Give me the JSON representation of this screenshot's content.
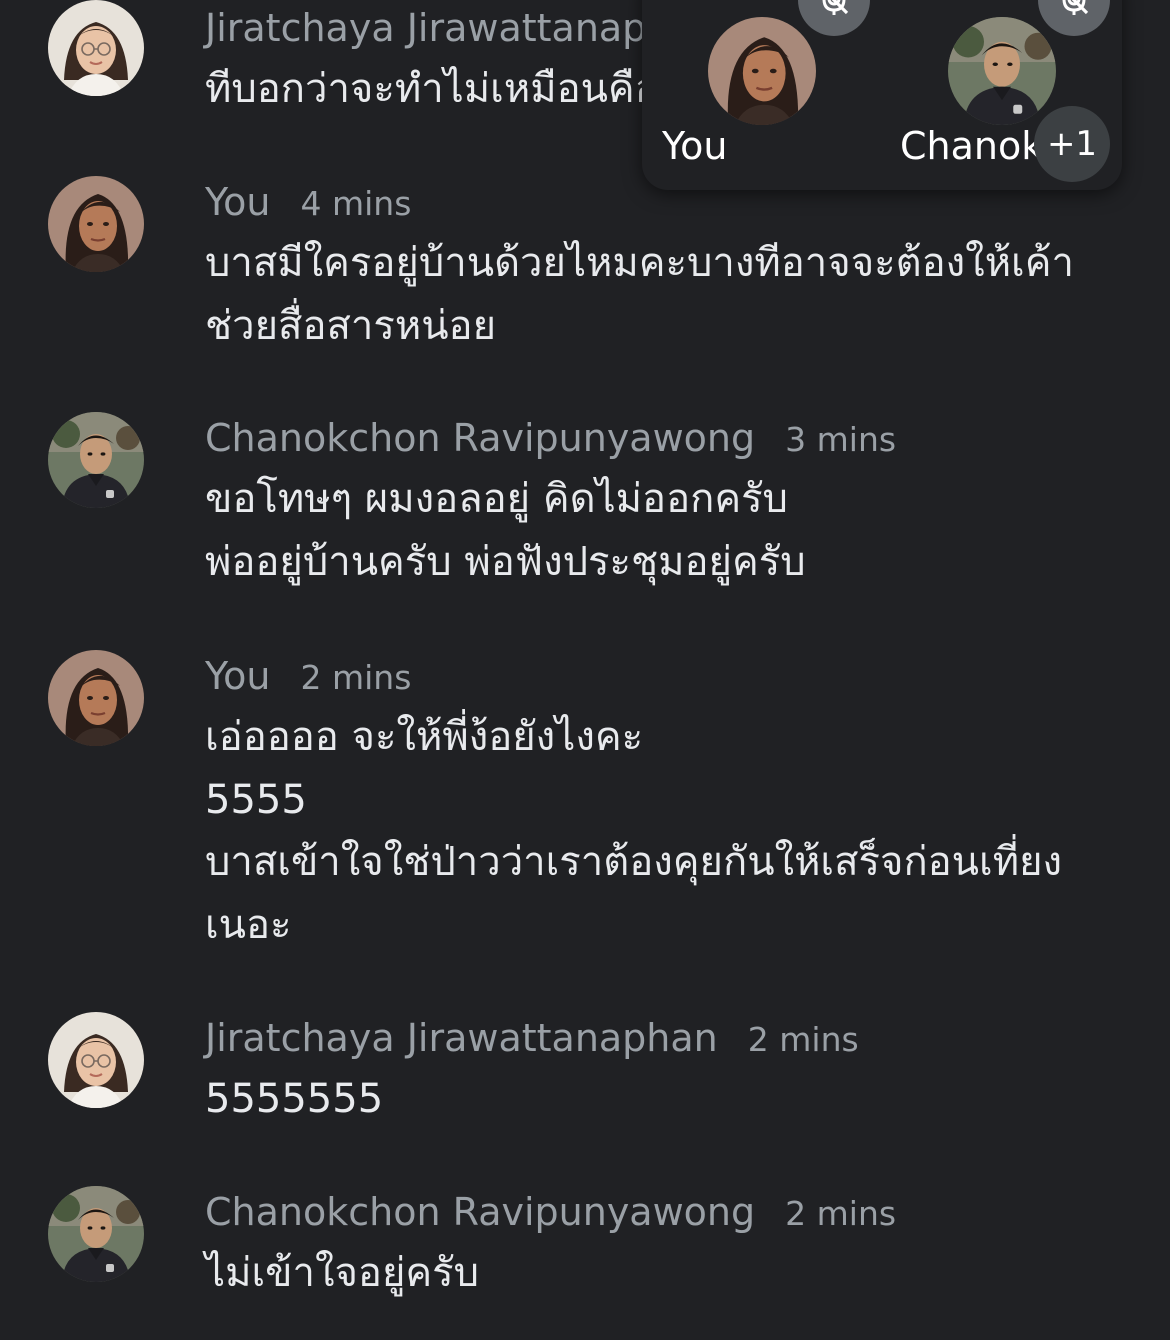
{
  "messages": [
    {
      "sender": "Jiratchaya Jirawattanaphan",
      "time": "",
      "lines": [
        "ทีบอกว่าจะทำไม่เหมือนคือ"
      ]
    },
    {
      "sender": "You",
      "time": "4 mins",
      "lines": [
        "บาสมีใครอยู่บ้านด้วยไหมคะบางทีอาจจะต้องให้เค้า",
        "ช่วยสื่อสารหน่อย"
      ]
    },
    {
      "sender": "Chanokchon Ravipunyawong",
      "time": "3 mins",
      "lines": [
        "ขอโทษๆ ผมงอลอยู่ คิดไม่ออกครับ",
        "พ่ออยู่บ้านครับ พ่อฟังประชุมอยู่ครับ"
      ]
    },
    {
      "sender": "You",
      "time": "2 mins",
      "lines": [
        "เอ่ออออ จะให้พี่ง้อยังไงคะ",
        "5555",
        "บาสเข้าใจใช่ป่าวว่าเราต้องคุยกันให้เสร็จก่อนเที่ยง",
        "เนอะ"
      ]
    },
    {
      "sender": "Jiratchaya Jirawattanaphan",
      "time": "2 mins",
      "lines": [
        "5555555"
      ]
    },
    {
      "sender": "Chanokchon Ravipunyawong",
      "time": "2 mins",
      "lines": [
        "ไม่เข้าใจอยู่ครับ"
      ]
    }
  ],
  "participants": {
    "tiles": [
      {
        "label": "You",
        "muted": true
      },
      {
        "label": "Chanokchon",
        "muted": true
      }
    ],
    "more_count": "+1"
  },
  "colors": {
    "background": "#202124",
    "secondary_text": "#9aa0a6",
    "primary_text": "#e8eaed",
    "mute_badge": "#5f6368"
  },
  "icons": {
    "mute": "mic-off-icon"
  }
}
